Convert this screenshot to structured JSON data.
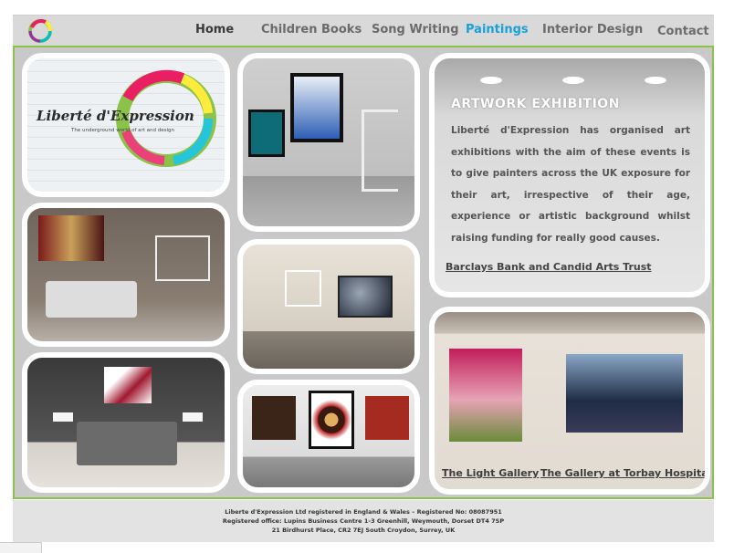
{
  "nav": {
    "items": [
      {
        "label": "Home"
      },
      {
        "label": "Children Books"
      },
      {
        "label": "Song Writing"
      },
      {
        "label": "Paintings"
      },
      {
        "label": "Interior Design"
      },
      {
        "label": "Contact"
      }
    ],
    "active_color": "#1aa0d8"
  },
  "logo": {
    "brand": "Liberté d'Expression",
    "tagline": "The underground world of art and design"
  },
  "exhibition": {
    "title": "ARTWORK EXHIBITION",
    "body": "Liberté d'Expression has organised art exhibitions with the aim of these events is to give painters across the UK exposure for their art, irrespective of their age, experience or artistic background whilst raising funding for really good causes.",
    "link": "Barclays Bank and Candid Arts Trust"
  },
  "gallery": {
    "link_1": "The Light Gallery",
    "link_2": "The Gallery at Torbay Hospital"
  },
  "footer": {
    "line_1": "Liberte d'Expression Ltd registered in England & Wales – Registered No: 08087951",
    "line_2": "Registered office: Lupins Business Centre 1-3 Greenhill, Weymouth, Dorset DT4 7SP",
    "line_3": "21 Birdhurst Place, CR2 7EJ South Croydon, Surrey, UK"
  },
  "colors": {
    "frame_border": "#8bc34a",
    "nav_background": "#d9d9d9"
  }
}
